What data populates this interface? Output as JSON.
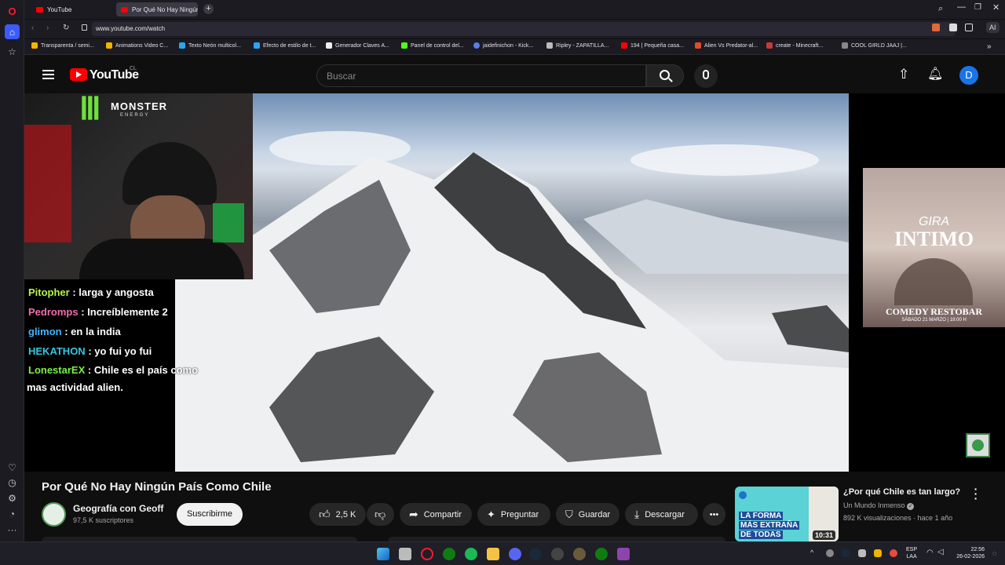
{
  "browser": {
    "tabs": [
      {
        "label": "YouTube"
      },
      {
        "label": "Por Qué No Hay Ningún P"
      }
    ],
    "url": "www.youtube.com/watch",
    "bookmarks": [
      "Transparenta / semi...",
      "Animations Video C...",
      "Texto Neón multicol...",
      "Efecto de estilo de t...",
      "Generador Claves A...",
      "Panel de control del...",
      "jaidefinichon - Kick...",
      "Ripley - ZAPATILLA...",
      "194 | Pequeña casa...",
      "Alien Vs Predator-al...",
      "create - Minecraft...",
      "COOL GIRLD JAAJ |..."
    ],
    "ai_label": "AI"
  },
  "youtube": {
    "logo_text": "YouTube",
    "country": "CL",
    "search_placeholder": "Buscar",
    "avatar_letter": "D"
  },
  "stream_overlay": {
    "brand": "MONSTER",
    "brand_sub": "ENERGY",
    "chat": [
      {
        "user": "Pitopher",
        "message": ": larga y angosta",
        "color": "#b7f34a"
      },
      {
        "user": "Pedromps",
        "message": ": Increíblemente 2",
        "color": "#f06db0"
      },
      {
        "user": "glimon",
        "message": ": en la india",
        "color": "#3fb6ff"
      },
      {
        "user": "HEKATHON",
        "message": ": yo fui yo fui",
        "color": "#35c7e0"
      },
      {
        "user": "LonestarEX",
        "message": ": Chile es el país como",
        "color": "#7cf04a"
      }
    ],
    "chat_wrap": "mas actividad alien.",
    "promo_top": "GIRA",
    "promo_title": "INTIMO",
    "promo_bottom": "COMEDY RESTOBAR",
    "promo_date": "SÁBADO 21 MARZO | 18:00 H"
  },
  "video": {
    "title": "Por Qué No Hay Ningún País Como Chile",
    "channel": "Geografía con Geoff",
    "subscribers": "97,5 K suscriptores",
    "subscribe_label": "Suscribirme",
    "likes": "2,5 K",
    "share_label": "Compartir",
    "ask_label": "Preguntar",
    "save_label": "Guardar",
    "download_label": "Descargar",
    "more_label": "•••"
  },
  "recommendation": {
    "title": "¿Por qué Chile es tan largo?",
    "channel": "Un Mundo Inmenso",
    "meta": "892 K visualizaciones · hace 1 año",
    "duration": "10:31",
    "thumb_text_1": "LA FORMA",
    "thumb_text_2": "MÁS EXTRAÑA",
    "thumb_text_3": "DE TODAS"
  },
  "taskbar": {
    "lang": "ESP",
    "lang2": "LAA",
    "time": "22:56",
    "date": "26-02-2026"
  }
}
